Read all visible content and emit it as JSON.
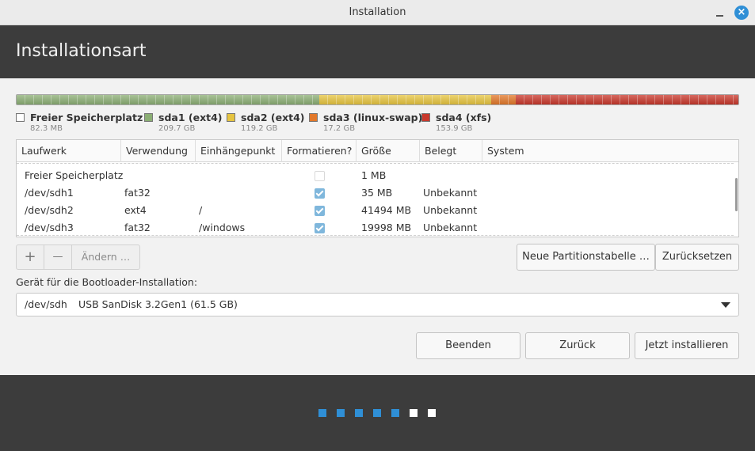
{
  "window": {
    "title": "Installation",
    "minimize_icon": "minimize-icon",
    "close_icon": "close-icon",
    "close_glyph": "×",
    "accent_color": "#2f8fd6"
  },
  "header": {
    "title": "Installationsart"
  },
  "partitions": [
    {
      "name": "Freier Speicherplatz",
      "size": "82.3 MB",
      "size_gb": 0.0823,
      "color": "#ffffff"
    },
    {
      "name": "sda1 (ext4)",
      "size": "209.7 GB",
      "size_gb": 209.7,
      "color": "#8bae74"
    },
    {
      "name": "sda2 (ext4)",
      "size": "119.2 GB",
      "size_gb": 119.2,
      "color": "#e6c440"
    },
    {
      "name": "sda3 (linux-swap)",
      "size": "17.2 GB",
      "size_gb": 17.2,
      "color": "#e2782a"
    },
    {
      "name": "sda4 (xfs)",
      "size": "153.9 GB",
      "size_gb": 153.9,
      "color": "#c8382c"
    }
  ],
  "table": {
    "columns": [
      "Laufwerk",
      "Verwendung",
      "Einhängepunkt",
      "Formatieren?",
      "Größe",
      "Belegt",
      "System"
    ],
    "rows": [
      {
        "device": "Freier Speicherplatz",
        "usage": "",
        "mount": "",
        "format": false,
        "format_enabled": false,
        "size": "1 MB",
        "used": "",
        "system": ""
      },
      {
        "device": "/dev/sdh1",
        "usage": "fat32",
        "mount": "",
        "format": true,
        "format_enabled": true,
        "size": "35 MB",
        "used": "Unbekannt",
        "system": ""
      },
      {
        "device": "/dev/sdh2",
        "usage": "ext4",
        "mount": "/",
        "format": true,
        "format_enabled": true,
        "size": "41494 MB",
        "used": "Unbekannt",
        "system": ""
      },
      {
        "device": "/dev/sdh3",
        "usage": "fat32",
        "mount": "/windows",
        "format": true,
        "format_enabled": true,
        "size": "19998 MB",
        "used": "Unbekannt",
        "system": ""
      }
    ]
  },
  "toolbar": {
    "add_label": "+",
    "remove_label": "—",
    "change_label": "Ändern …"
  },
  "actions": {
    "new_table_label": "Neue Partitionstabelle …",
    "reset_label": "Zurücksetzen"
  },
  "bootloader": {
    "label": "Gerät für die Bootloader-Installation:",
    "device": "/dev/sdh",
    "description": "USB  SanDisk 3.2Gen1 (61.5 GB)"
  },
  "nav": {
    "quit_label": "Beenden",
    "back_label": "Zurück",
    "install_label": "Jetzt installieren"
  },
  "progress": {
    "steps_total": 7,
    "steps_done": 5,
    "done_color": "#2f8fd6",
    "todo_color": "#ffffff"
  }
}
